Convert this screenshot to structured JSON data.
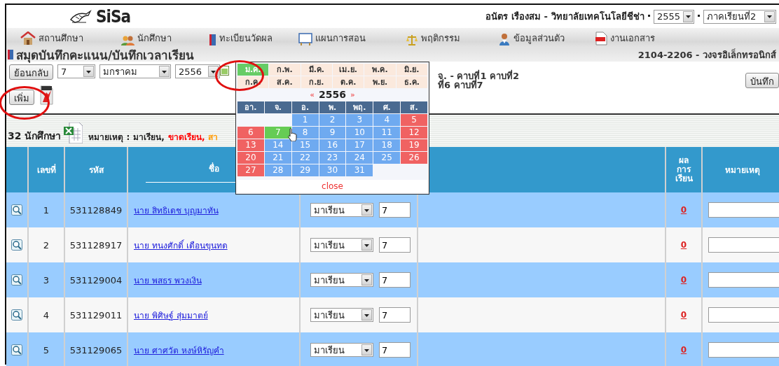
{
  "header": {
    "logo": "SiSa",
    "user": "อนัตร เรืองสม",
    "separator": "-",
    "school": "วิทยาลัยเทคโนโลยีชีช่า",
    "year_select": "2555",
    "term_select": "ภาคเรียนที่2"
  },
  "nav": [
    {
      "label": "สถานศึกษา",
      "kind": "house"
    },
    {
      "label": "นักศึกษา",
      "kind": "people"
    },
    {
      "label": "ทะเบียนวัดผล",
      "kind": "book"
    },
    {
      "label": "แผนการสอน",
      "kind": "board"
    },
    {
      "label": "พฤติกรรม",
      "kind": "scale"
    },
    {
      "label": "ข้อมูลส่วนตัว",
      "kind": "person"
    },
    {
      "label": "งานเอกสาร",
      "kind": "doc"
    }
  ],
  "page_title": "สมุดบันทึกคะแนน/บันทึกเวลาเรียน",
  "course": "2104-2206 - วงจรอิเล็กทรอนิกส์",
  "toolbar": {
    "back_button": "ย้อนกลับ",
    "day_select": "7",
    "month_select": "มกราคม",
    "year_select": "2556",
    "periods": [
      "จ. - คาบที่1 คาบที่2",
      "ที่6 คาบที่7"
    ],
    "save_button": "บันทึก",
    "add_button": "เพิ่ม"
  },
  "summary": {
    "count": "32 นักศึกษา",
    "legend_label": "หมายเหตุ :",
    "legend": [
      {
        "text": "มาเรียน,",
        "color": "#222222"
      },
      {
        "text": "ขาดเรียน,",
        "color": "#ff0000"
      },
      {
        "text": "สา",
        "color": "#ff9900"
      }
    ]
  },
  "table": {
    "columns": [
      "เลขที่",
      "รหัส",
      "ชื่อ",
      "ผลการเรียน",
      "หมายเหตุ"
    ],
    "rows": [
      {
        "no": "1",
        "code": "531128849",
        "name": "นาย สิทธิเดช บุญมาทัน",
        "status": "มาเรียน",
        "periods": "7",
        "result": "0"
      },
      {
        "no": "2",
        "code": "531128917",
        "name": "นาย ทนงศักดิ์ เดือนขุนทด",
        "status": "มาเรียน",
        "periods": "7",
        "result": "0"
      },
      {
        "no": "3",
        "code": "531129004",
        "name": "นาย พสธร พวงเงิน",
        "status": "มาเรียน",
        "periods": "7",
        "result": "0"
      },
      {
        "no": "4",
        "code": "531129011",
        "name": "นาย พิศิษฐ์ สุ่มมาตย์",
        "status": "มาเรียน",
        "periods": "7",
        "result": "0"
      },
      {
        "no": "5",
        "code": "531129065",
        "name": "นาย ศาศวัต หงษ์หิรัญคำ",
        "status": "มาเรียน",
        "periods": "7",
        "result": "0"
      }
    ]
  },
  "calendar": {
    "months": [
      {
        "label": "ม.ค.",
        "selected": true
      },
      {
        "label": "ก.พ.",
        "selected": false
      },
      {
        "label": "มี.ค.",
        "selected": false
      },
      {
        "label": "เม.ย.",
        "selected": false
      },
      {
        "label": "พ.ค.",
        "selected": false
      },
      {
        "label": "มิ.ย.",
        "selected": false
      },
      {
        "label": "ก.ค.",
        "selected": false
      },
      {
        "label": "ส.ค.",
        "selected": false
      },
      {
        "label": "ก.ย.",
        "selected": false
      },
      {
        "label": "ต.ค.",
        "selected": false
      },
      {
        "label": "พ.ย.",
        "selected": false
      },
      {
        "label": "ธ.ค.",
        "selected": false
      }
    ],
    "prev": "«",
    "year": "2556",
    "next": "»",
    "weekdays": [
      "อา.",
      "จ.",
      "อ.",
      "พ.",
      "พฤ.",
      "ศ.",
      "ส."
    ],
    "weeks": [
      [
        {
          "kind": "blank"
        },
        {
          "kind": "blank"
        },
        {
          "label": "1",
          "kind": "weekday"
        },
        {
          "label": "2",
          "kind": "weekday"
        },
        {
          "label": "3",
          "kind": "weekday"
        },
        {
          "label": "4",
          "kind": "weekday"
        },
        {
          "label": "5",
          "kind": "weekend"
        }
      ],
      [
        {
          "label": "6",
          "kind": "weekend"
        },
        {
          "label": "7",
          "kind": "today"
        },
        {
          "label": "8",
          "kind": "weekday"
        },
        {
          "label": "9",
          "kind": "weekday"
        },
        {
          "label": "10",
          "kind": "weekday"
        },
        {
          "label": "11",
          "kind": "weekday"
        },
        {
          "label": "12",
          "kind": "weekend"
        }
      ],
      [
        {
          "label": "13",
          "kind": "weekend"
        },
        {
          "label": "14",
          "kind": "weekday"
        },
        {
          "label": "15",
          "kind": "weekday"
        },
        {
          "label": "16",
          "kind": "weekday"
        },
        {
          "label": "17",
          "kind": "weekday"
        },
        {
          "label": "18",
          "kind": "weekday"
        },
        {
          "label": "19",
          "kind": "weekend"
        }
      ],
      [
        {
          "label": "20",
          "kind": "weekend"
        },
        {
          "label": "21",
          "kind": "weekday"
        },
        {
          "label": "22",
          "kind": "weekday"
        },
        {
          "label": "23",
          "kind": "weekday"
        },
        {
          "label": "24",
          "kind": "weekday"
        },
        {
          "label": "25",
          "kind": "weekday"
        },
        {
          "label": "26",
          "kind": "weekend"
        }
      ],
      [
        {
          "label": "27",
          "kind": "weekend"
        },
        {
          "label": "28",
          "kind": "weekday"
        },
        {
          "label": "29",
          "kind": "weekday"
        },
        {
          "label": "30",
          "kind": "weekday"
        },
        {
          "label": "31",
          "kind": "weekday"
        },
        {
          "kind": "blank"
        },
        {
          "kind": "blank"
        }
      ]
    ],
    "close": "close"
  }
}
